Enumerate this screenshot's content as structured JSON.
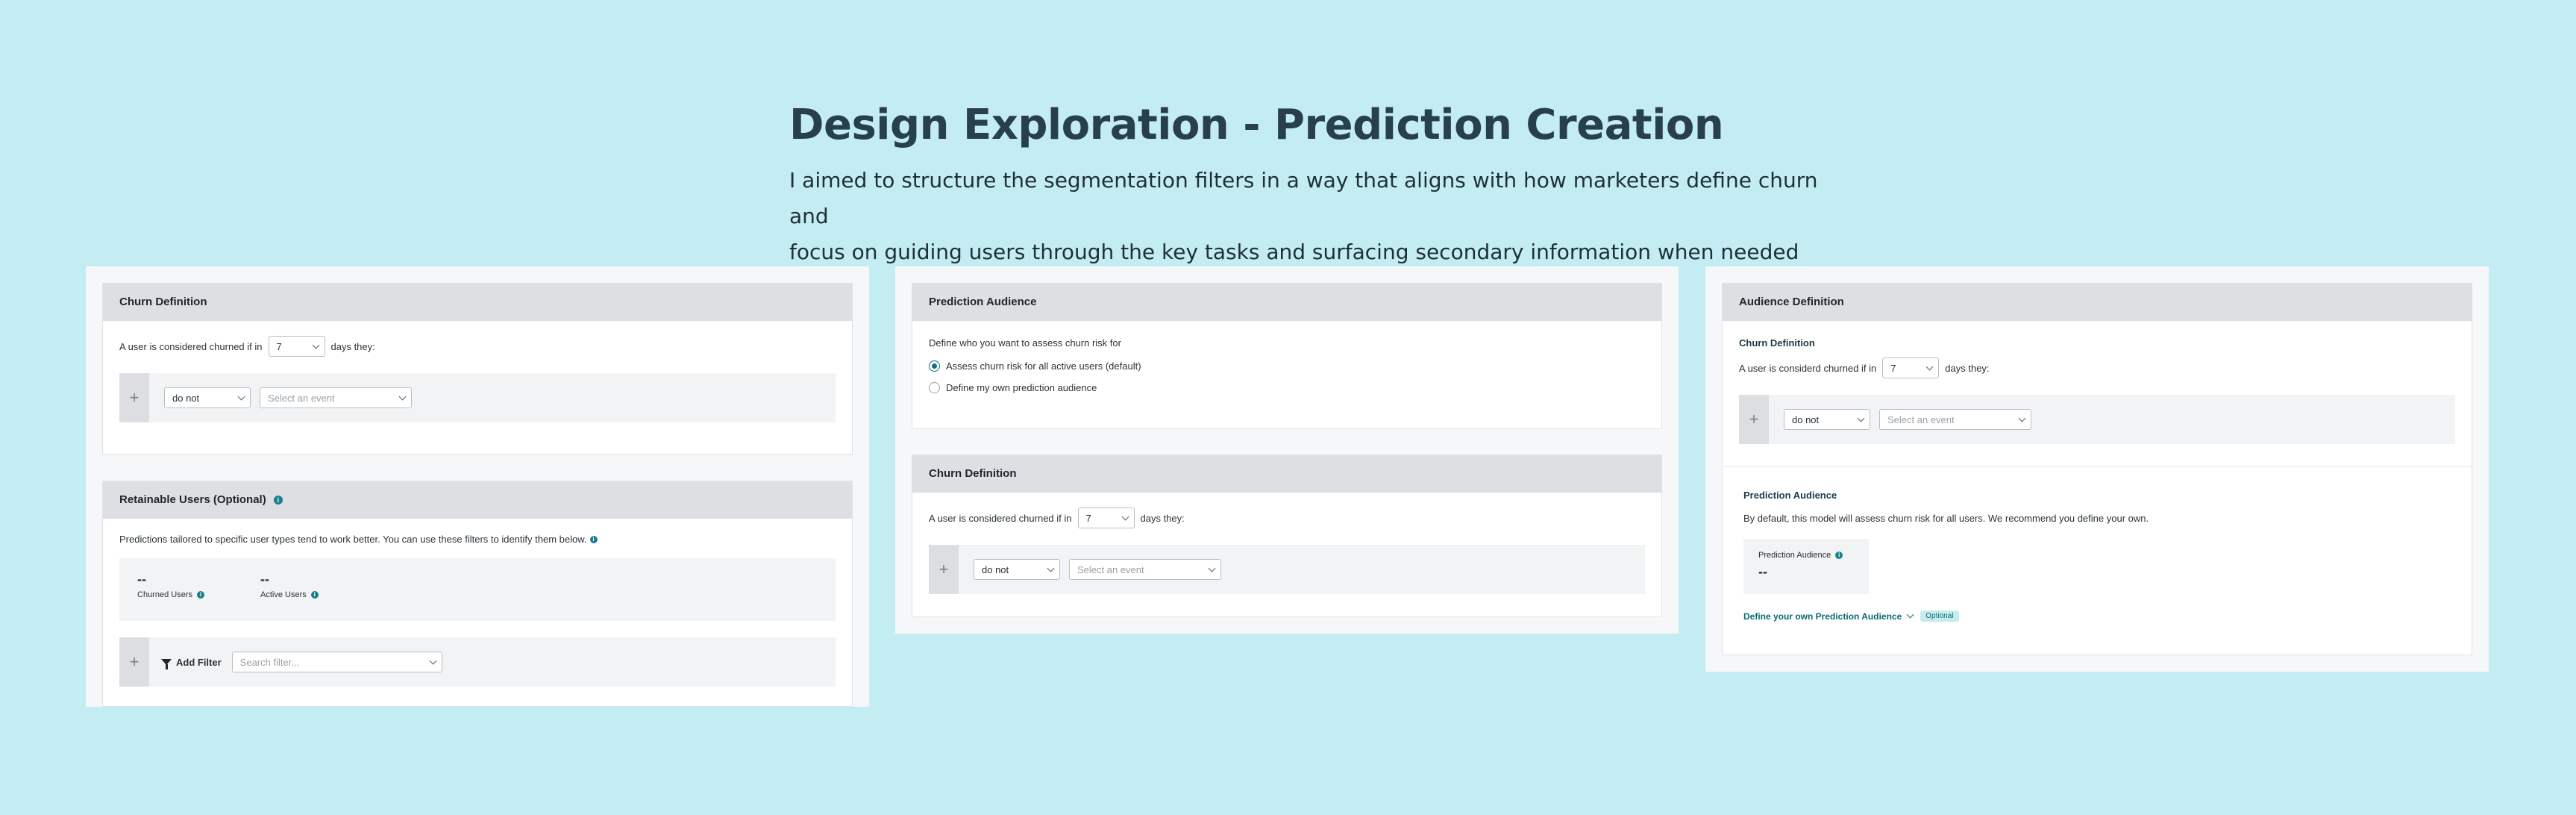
{
  "header": {
    "title": "Design Exploration - Prediction Creation",
    "subtitle_line1": "I aimed to structure the segmentation filters in a way that aligns with how marketers define churn and",
    "subtitle_line2": "focus on guiding users through the key tasks and surfacing secondary information when needed"
  },
  "panel1": {
    "churn": {
      "title": "Churn Definition",
      "prefix": "A user is considered churned if in",
      "days_value": "7",
      "suffix": "days they:",
      "plus": "+",
      "condition_value": "do not",
      "event_placeholder": "Select an event"
    },
    "retainable": {
      "title": "Retainable Users (Optional)",
      "info": "i",
      "description": "Predictions tailored to specific user types tend to work better. You can use these filters to identify them below.",
      "stats": [
        {
          "value": "--",
          "label": "Churned Users"
        },
        {
          "value": "--",
          "label": "Active Users"
        }
      ],
      "plus": "+",
      "add_filter_label": "Add Filter",
      "search_placeholder": "Search filter..."
    }
  },
  "panel2": {
    "audience": {
      "title": "Prediction Audience",
      "prompt": "Define who you want to assess churn risk for",
      "options": [
        {
          "label": "Assess churn risk for all active users (default)",
          "selected": true
        },
        {
          "label": "Define my own prediction audience",
          "selected": false
        }
      ]
    },
    "churn": {
      "title": "Churn Definition",
      "prefix": "A user is considered churned if in",
      "days_value": "7",
      "suffix": "days they:",
      "plus": "+",
      "condition_value": "do not",
      "event_placeholder": "Select an event"
    }
  },
  "panel3": {
    "title": "Audience Definition",
    "churn": {
      "subtitle": "Churn Definition",
      "prefix": "A user is considerd churned if in",
      "days_value": "7",
      "suffix": "days they:",
      "plus": "+",
      "condition_value": "do not",
      "event_placeholder": "Select an event"
    },
    "audience": {
      "subtitle": "Prediction Audience",
      "description": "By default, this model will assess churn risk for all users. We recommend you define your own.",
      "box_label": "Prediction Audience",
      "box_value": "--",
      "link_label": "Define your own Prediction Audience",
      "badge": "Optional"
    }
  },
  "colors": {
    "background": "#c4edf3",
    "panel": "#f5f7f8",
    "card_header": "#dedfe3",
    "accent": "#0b6c72",
    "info_icon": "#18808d"
  }
}
